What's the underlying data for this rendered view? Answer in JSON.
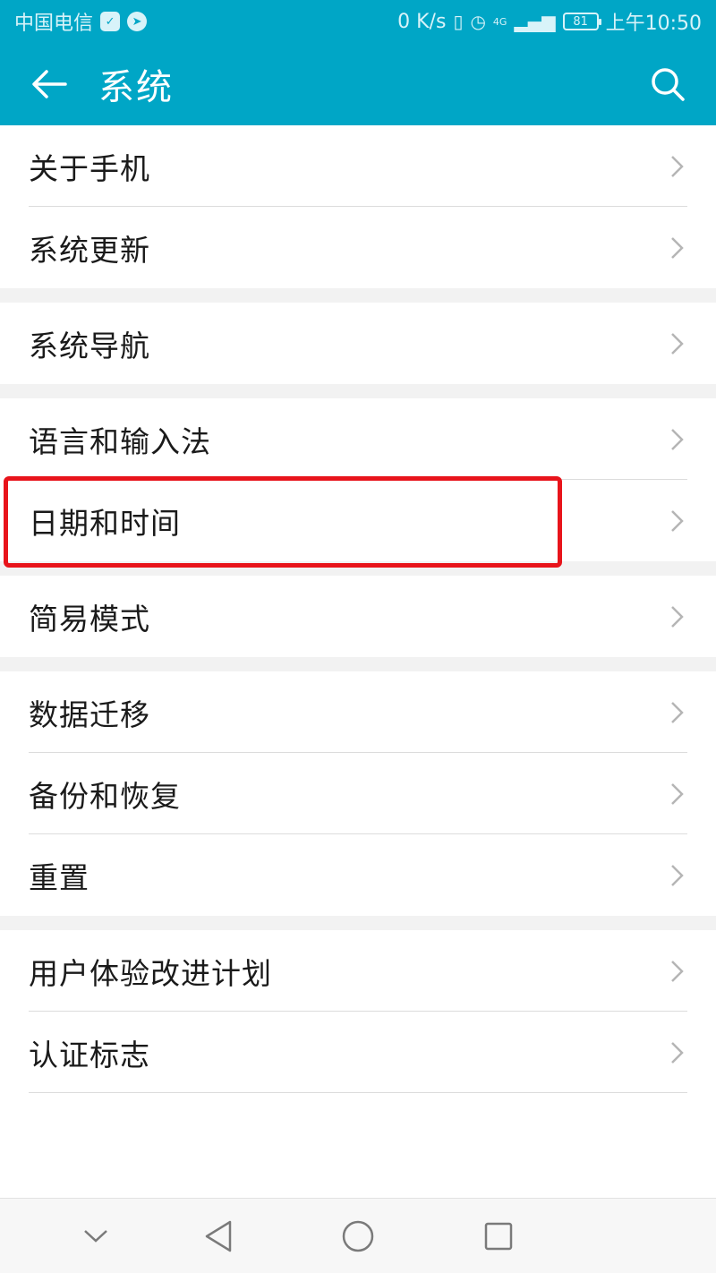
{
  "status_bar": {
    "carrier": "中国电信",
    "net_speed": "0 K/s",
    "network": "4G",
    "battery": "81",
    "time": "上午10:50"
  },
  "header": {
    "title": "系统"
  },
  "groups": [
    {
      "items": [
        "关于手机",
        "系统更新"
      ]
    },
    {
      "items": [
        "系统导航"
      ]
    },
    {
      "items": [
        "语言和输入法",
        "日期和时间"
      ]
    },
    {
      "items": [
        "简易模式"
      ]
    },
    {
      "items": [
        "数据迁移",
        "备份和恢复",
        "重置"
      ]
    },
    {
      "items": [
        "用户体验改进计划",
        "认证标志"
      ]
    }
  ],
  "highlighted_item": "日期和时间",
  "colors": {
    "accent": "#00a6c6",
    "highlight_border": "#e8141b",
    "section_gap": "#f2f2f2"
  }
}
